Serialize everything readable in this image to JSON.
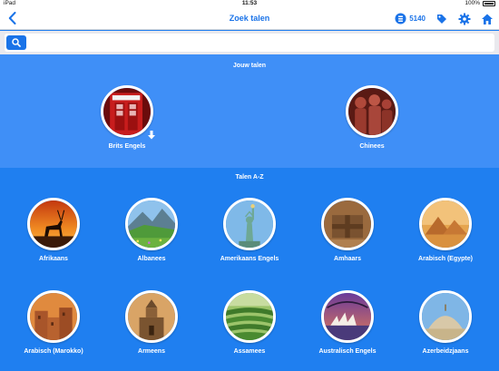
{
  "status_bar": {
    "device": "iPad",
    "time": "11:53",
    "battery": "100%"
  },
  "nav": {
    "title": "Zoek talen",
    "coins": "5140"
  },
  "search": {
    "placeholder": ""
  },
  "sections": {
    "mine_title": "Jouw talen",
    "az_title": "Talen A-Z"
  },
  "my_languages": [
    {
      "name": "Brits Engels"
    },
    {
      "name": "Chinees"
    }
  ],
  "languages": [
    {
      "name": "Afrikaans"
    },
    {
      "name": "Albanees"
    },
    {
      "name": "Amerikaans Engels"
    },
    {
      "name": "Amhaars"
    },
    {
      "name": "Arabisch (Egypte)"
    },
    {
      "name": "Arabisch (Marokko)"
    },
    {
      "name": "Armeens"
    },
    {
      "name": "Assamees"
    },
    {
      "name": "Australisch Engels"
    },
    {
      "name": "Azerbeidzjaans"
    }
  ],
  "colors": {
    "accent": "#1a73e8",
    "section_mine": "#3f8ff7",
    "section_az": "#1f7ff0"
  }
}
